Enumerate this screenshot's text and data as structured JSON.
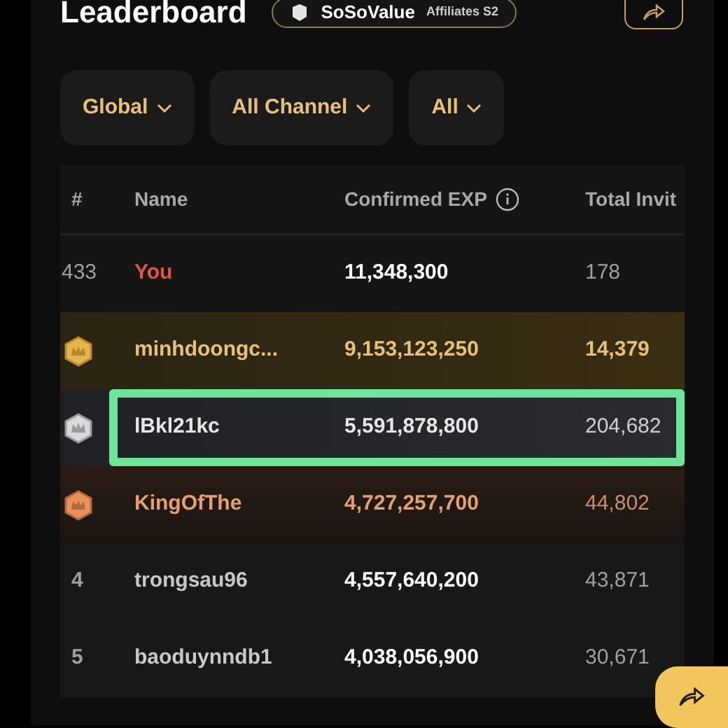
{
  "header": {
    "title": "Leaderboard",
    "badge": {
      "brand": "SoSoValue",
      "label": "Affiliates S2"
    }
  },
  "filters": [
    {
      "label": "Global"
    },
    {
      "label": "All Channel"
    },
    {
      "label": "All"
    }
  ],
  "table": {
    "columns": [
      "#",
      "Name",
      "Confirmed EXP",
      "Total Invit"
    ],
    "rows": [
      {
        "kind": "you",
        "rank": "433",
        "name": "You",
        "exp": "11,348,300",
        "invites": "178",
        "selected": false
      },
      {
        "kind": "gold",
        "name": "minhdoongc...",
        "exp": "9,153,123,250",
        "invites": "14,379",
        "selected": false
      },
      {
        "kind": "silver",
        "name": "lBkl21kc",
        "exp": "5,591,878,800",
        "invites": "204,682",
        "selected": true
      },
      {
        "kind": "bronze",
        "name": "KingOfThe",
        "exp": "4,727,257,700",
        "invites": "44,802",
        "selected": false
      },
      {
        "kind": "plain",
        "rank": "4",
        "name": "trongsau96",
        "exp": "4,557,640,200",
        "invites": "43,871",
        "selected": false
      },
      {
        "kind": "plain",
        "rank": "5",
        "name": "baoduynndb1",
        "exp": "4,038,056,900",
        "invites": "30,671",
        "selected": false
      }
    ]
  }
}
